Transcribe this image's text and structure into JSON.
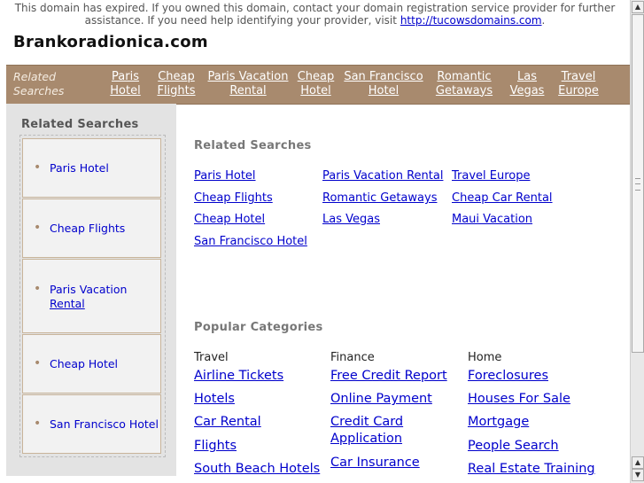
{
  "notice": {
    "line": "This domain has expired. If you owned this domain, contact your domain registration service provider for further assistance. If you need help identifying your provider, visit",
    "link": "http://tucowsdomains.com",
    "end": "."
  },
  "site_title": "Brankoradionica.com",
  "nav": {
    "label_line1": "Related",
    "label_line2": "Searches",
    "links": [
      {
        "line1": "Paris",
        "line2": "Hotel"
      },
      {
        "line1": "Cheap",
        "line2": "Flights"
      },
      {
        "line1": "Paris Vacation",
        "line2": "Rental"
      },
      {
        "line1": "Cheap",
        "line2": "Hotel"
      },
      {
        "line1": "San Francisco",
        "line2": "Hotel"
      },
      {
        "line1": "Romantic",
        "line2": "Getaways"
      },
      {
        "line1": "Las",
        "line2": "Vegas"
      },
      {
        "line1": "Travel",
        "line2": "Europe"
      }
    ]
  },
  "sidebar": {
    "title": "Related Searches",
    "items": [
      {
        "line1": "Paris Hotel",
        "line2": ""
      },
      {
        "line1": "Cheap Flights",
        "line2": ""
      },
      {
        "line1": "Paris Vacation",
        "line2": "Rental"
      },
      {
        "line1": "Cheap Hotel",
        "line2": ""
      },
      {
        "line1": "San Francisco Hotel",
        "line2": ""
      }
    ]
  },
  "main": {
    "related_title": "Related Searches",
    "related_links": [
      "Paris Hotel",
      "Cheap Flights",
      "Cheap Hotel",
      "San Francisco Hotel",
      "Paris Vacation Rental",
      "Romantic Getaways",
      "Las Vegas",
      "Travel Europe",
      "Cheap Car Rental",
      "Maui Vacation"
    ],
    "popular_title": "Popular Categories",
    "categories": [
      {
        "heading": "Travel",
        "links": [
          "Airline Tickets",
          "Hotels",
          "Car Rental",
          "Flights",
          "South Beach Hotels"
        ]
      },
      {
        "heading": "Finance",
        "links": [
          "Free Credit Report",
          "Online Payment",
          "Credit Card Application",
          "Car Insurance"
        ]
      },
      {
        "heading": "Home",
        "links": [
          "Foreclosures",
          "Houses For Sale",
          "Mortgage",
          "People Search",
          "Real Estate Training"
        ]
      }
    ]
  },
  "colors": {
    "nav_bg": "#a88a6e",
    "link": "#0000cc",
    "sidebar_bg": "#e3e3e3"
  }
}
